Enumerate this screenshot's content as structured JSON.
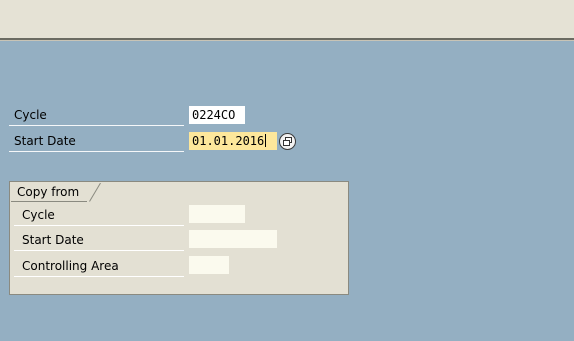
{
  "form": {
    "cycle_label": "Cycle",
    "cycle_value": "0224CO",
    "start_date_label": "Start Date",
    "start_date_value": "01.01.2016"
  },
  "copy_from": {
    "title": "Copy from",
    "cycle_label": "Cycle",
    "cycle_value": "",
    "start_date_label": "Start Date",
    "start_date_value": "",
    "controlling_area_label": "Controlling Area",
    "controlling_area_value": ""
  },
  "icons": {
    "value_help": "possible-entries-icon"
  },
  "colors": {
    "background": "#94afc2",
    "toolbar": "#e5e2d5",
    "focused_field": "#fde79b",
    "group_box": "#e3e0d3"
  }
}
